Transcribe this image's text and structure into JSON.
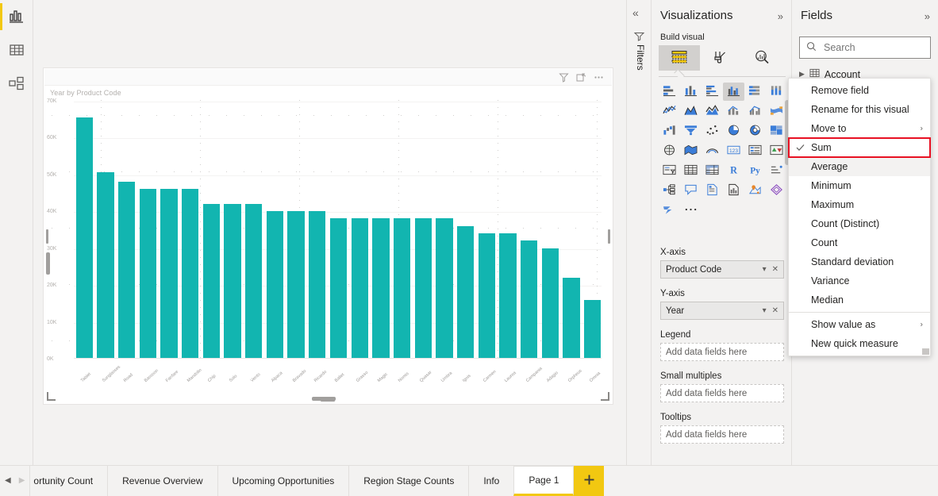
{
  "app": {
    "left_rail": [
      {
        "name": "report-view",
        "icon": "bar-chart-icon",
        "active": true
      },
      {
        "name": "data-view",
        "icon": "table-icon",
        "active": false
      },
      {
        "name": "model-view",
        "icon": "model-icon",
        "active": false
      }
    ]
  },
  "visual": {
    "title": "Year by Product Code",
    "header_icons": [
      "filter-icon",
      "focus-mode-icon",
      "more-options-icon"
    ]
  },
  "chart_data": {
    "type": "bar",
    "title": "Year by Product Code",
    "xlabel": "Product Code",
    "ylabel": "Year",
    "ylim": [
      0,
      70000
    ],
    "yticks": [
      "0K",
      "10K",
      "20K",
      "30K",
      "40K",
      "50K",
      "60K",
      "70K"
    ],
    "ytick_values": [
      0,
      10000,
      20000,
      30000,
      40000,
      50000,
      60000,
      70000
    ],
    "grid": true,
    "legend": null,
    "bar_color": "#12b5b0",
    "categories": [
      "Tablet",
      "Sunglasses",
      "Road",
      "Bassoon",
      "Fanfare",
      "Mandolin",
      "Chip",
      "Solo",
      "Vento",
      "Alpaca",
      "Bravado",
      "Ricardo",
      "Ballet",
      "Grasso",
      "Magic",
      "Nomis",
      "Quasar",
      "Umbra",
      "Ignis",
      "Carmen",
      "Laurea",
      "Campania",
      "Adagio",
      "Orpheus",
      "Omnia"
    ],
    "values": [
      65560,
      50530,
      48080,
      46090,
      46090,
      46090,
      42080,
      42080,
      42080,
      40070,
      40070,
      40070,
      38060,
      38060,
      38060,
      38060,
      38060,
      38060,
      36050,
      34050,
      34050,
      32040,
      30040,
      22020,
      16010
    ]
  },
  "tabs": {
    "nav": {
      "prev": "◀",
      "next": "▶"
    },
    "items": [
      {
        "label": "ortunity Count",
        "active": false,
        "clipped": true
      },
      {
        "label": "Revenue Overview",
        "active": false
      },
      {
        "label": "Upcoming Opportunities",
        "active": false
      },
      {
        "label": "Region Stage Counts",
        "active": false
      },
      {
        "label": "Info",
        "active": false
      },
      {
        "label": "Page 1",
        "active": true
      }
    ],
    "add_page_icon": "plus-icon"
  },
  "filters": {
    "collapse_icon": "chevron-double-left-icon",
    "icon": "filter-icon",
    "label": "Filters"
  },
  "visualizations": {
    "title": "Visualizations",
    "expand_icon": "chevron-double-right-icon",
    "section": "Build visual",
    "tabs": [
      {
        "name": "build-visual-tab",
        "icon": "fields-grid-icon",
        "selected": true
      },
      {
        "name": "format-visual-tab",
        "icon": "paintbrush-icon",
        "selected": false
      },
      {
        "name": "analytics-tab",
        "icon": "magnifier-chart-icon",
        "selected": false
      }
    ],
    "gallery": [
      {
        "icon": "stacked-bar-chart-icon",
        "selected": false
      },
      {
        "icon": "stacked-column-chart-icon",
        "selected": false
      },
      {
        "icon": "clustered-bar-chart-icon",
        "selected": false
      },
      {
        "icon": "clustered-column-chart-icon",
        "selected": true
      },
      {
        "icon": "100-stacked-bar-chart-icon",
        "selected": false
      },
      {
        "icon": "100-stacked-column-chart-icon",
        "selected": false
      },
      {
        "icon": "line-chart-icon",
        "selected": false
      },
      {
        "icon": "area-chart-icon",
        "selected": false
      },
      {
        "icon": "stacked-area-chart-icon",
        "selected": false
      },
      {
        "icon": "line-stacked-column-chart-icon",
        "selected": false
      },
      {
        "icon": "line-clustered-column-chart-icon",
        "selected": false
      },
      {
        "icon": "ribbon-chart-icon",
        "selected": false
      },
      {
        "icon": "waterfall-chart-icon",
        "selected": false
      },
      {
        "icon": "funnel-chart-icon",
        "selected": false
      },
      {
        "icon": "scatter-chart-icon",
        "selected": false
      },
      {
        "icon": "pie-chart-icon",
        "selected": false
      },
      {
        "icon": "donut-chart-icon",
        "selected": false
      },
      {
        "icon": "treemap-icon",
        "selected": false
      },
      {
        "icon": "map-icon",
        "selected": false
      },
      {
        "icon": "filled-map-icon",
        "selected": false
      },
      {
        "icon": "arcgis-map-icon",
        "selected": false
      },
      {
        "icon": "card-icon",
        "selected": false
      },
      {
        "icon": "multi-row-card-icon",
        "selected": false
      },
      {
        "icon": "kpi-icon",
        "selected": false
      },
      {
        "icon": "slicer-icon",
        "selected": false
      },
      {
        "icon": "table-icon",
        "selected": false
      },
      {
        "icon": "matrix-icon",
        "selected": false
      },
      {
        "icon": "r-script-visual-icon",
        "selected": false
      },
      {
        "icon": "python-visual-icon",
        "selected": false
      },
      {
        "icon": "key-influencers-icon",
        "selected": false
      },
      {
        "icon": "decomposition-tree-icon",
        "selected": false
      },
      {
        "icon": "qna-icon",
        "selected": false
      },
      {
        "icon": "smart-narrative-icon",
        "selected": false
      },
      {
        "icon": "paginated-report-icon",
        "selected": false
      },
      {
        "icon": "azure-map-icon",
        "selected": false
      },
      {
        "icon": "power-apps-icon",
        "selected": false
      },
      {
        "icon": "power-automate-icon",
        "selected": false
      },
      {
        "icon": "more-visuals-icon",
        "selected": false
      }
    ],
    "wells": [
      {
        "label": "X-axis",
        "value": "Product Code",
        "filled": true
      },
      {
        "label": "Y-axis",
        "value": "Year",
        "filled": true
      },
      {
        "label": "Legend",
        "value": "Add data fields here",
        "filled": false
      },
      {
        "label": "Small multiples",
        "value": "Add data fields here",
        "filled": false
      },
      {
        "label": "Tooltips",
        "value": "Add data fields here",
        "filled": false
      }
    ],
    "well_controls": {
      "dropdown": "chevron-down-icon",
      "remove": "close-icon"
    }
  },
  "fields": {
    "title": "Fields",
    "expand_icon": "chevron-double-right-icon",
    "search_placeholder": "Search",
    "search_value": "",
    "search_icon": "search-icon",
    "tree": [
      {
        "label": "Account",
        "icon": "table-icon",
        "expanded": false
      }
    ]
  },
  "context_menu": {
    "items": [
      {
        "label": "Remove field",
        "type": "item"
      },
      {
        "label": "Rename for this visual",
        "type": "item"
      },
      {
        "label": "Move to",
        "type": "submenu"
      },
      {
        "label": "Sum",
        "type": "item",
        "checked": true,
        "highlighted": true
      },
      {
        "label": "Average",
        "type": "item",
        "hovered": true
      },
      {
        "label": "Minimum",
        "type": "item"
      },
      {
        "label": "Maximum",
        "type": "item"
      },
      {
        "label": "Count (Distinct)",
        "type": "item"
      },
      {
        "label": "Count",
        "type": "item"
      },
      {
        "label": "Standard deviation",
        "type": "item"
      },
      {
        "label": "Variance",
        "type": "item"
      },
      {
        "label": "Median",
        "type": "item"
      },
      {
        "label": "__sep__",
        "type": "separator"
      },
      {
        "label": "Show value as",
        "type": "submenu"
      },
      {
        "label": "New quick measure",
        "type": "item"
      }
    ]
  },
  "colors": {
    "accent": "#f2c811",
    "bar": "#12b5b0",
    "highlight": "#e81123",
    "panel_bg": "#f3f2f1"
  }
}
